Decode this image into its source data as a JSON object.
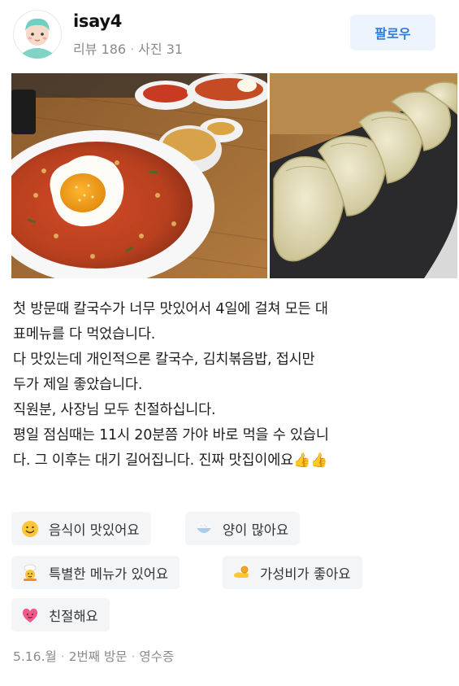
{
  "user": {
    "name": "isay4",
    "reviews_label": "리뷰 186",
    "photos_label": "사진 31",
    "separator": "·"
  },
  "follow_button": {
    "label": "팔로우"
  },
  "colors": {
    "follow_text": "#2f7ad8",
    "follow_bg": "#eef4fd",
    "tag_bg": "#f4f5f7",
    "meta_text": "#8a8a8a"
  },
  "review": {
    "lines": [
      "첫 방문때 칼국수가 너무 맛있어서 4일에 걸쳐 모든 대",
      "표메뉴를 다 먹었습니다.",
      "다 맛있는데 개인적으론 칼국수, 김치볶음밥, 접시만",
      "두가 제일 좋았습니다.",
      "직원분, 사장님 모두 친절하십니다.",
      "평일 점심때는 11시 20분쯤 가야 바로 먹을 수 있습니",
      "다. 그 이후는 대기 길어집니다. 진짜 맛집이에요"
    ],
    "emoji": "👍👍"
  },
  "tags": [
    {
      "label": "음식이 맛있어요",
      "icon": "smile-face-icon"
    },
    {
      "label": "양이 많아요",
      "icon": "rice-bowl-icon"
    },
    {
      "label": "특별한 메뉴가 있어요",
      "icon": "chef-icon"
    },
    {
      "label": "가성비가 좋아요",
      "icon": "money-hand-icon"
    },
    {
      "label": "친절해요",
      "icon": "heart-face-icon"
    }
  ],
  "footer": {
    "date": "5.16.월",
    "visit": "2번째 방문",
    "receipt": "영수증",
    "separator": "·"
  }
}
